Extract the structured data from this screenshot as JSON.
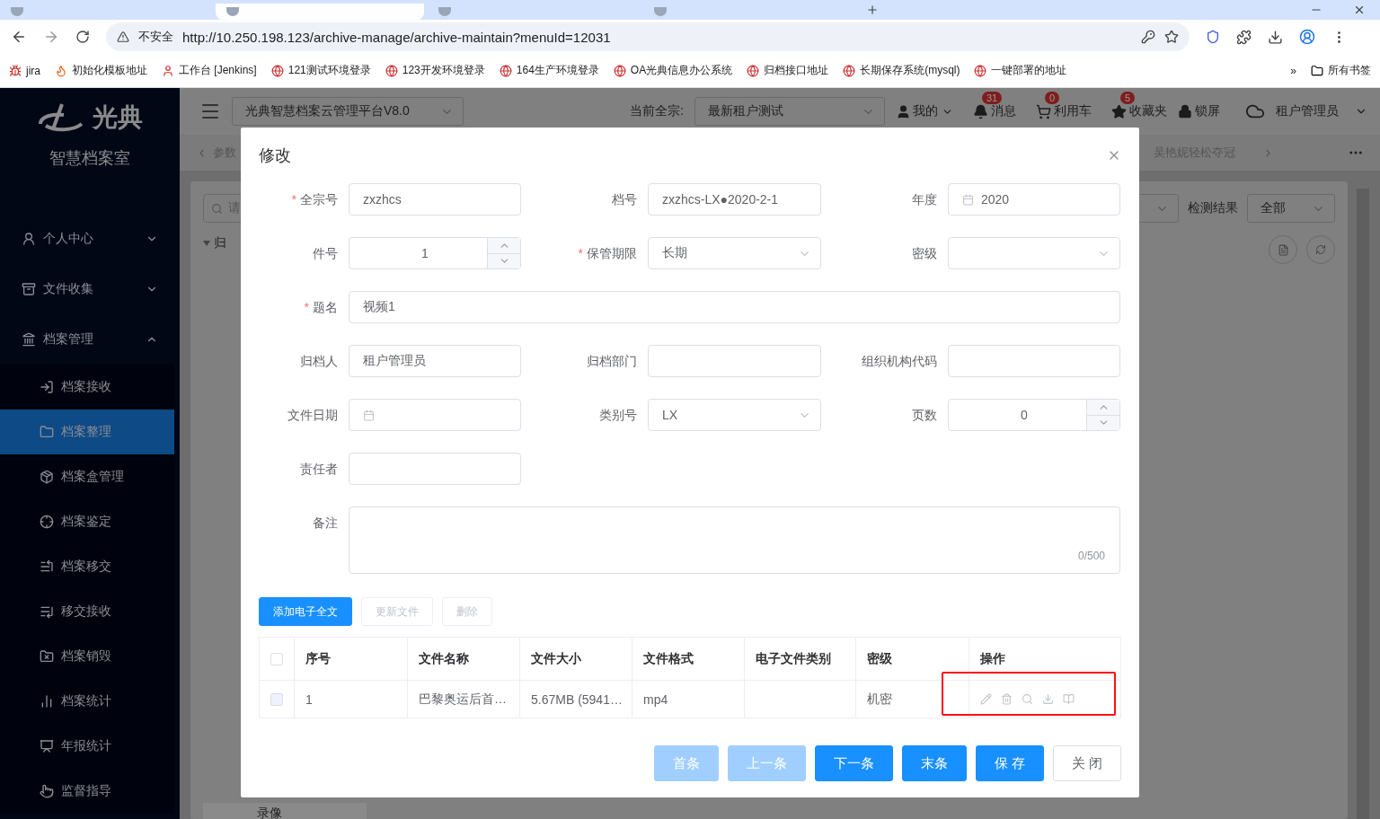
{
  "browser": {
    "insecure_label": "不安全",
    "url": "http://10.250.198.123/archive-manage/archive-maintain?menuId=12031",
    "bookmarks": [
      "jira",
      "初始化模板地址",
      "工作台 [Jenkins]",
      "121测试环境登录",
      "123开发环境登录",
      "164生产环境登录",
      "OA光典信息办公系统",
      "归档接口地址",
      "长期保存系统(mysql)",
      "一键部署的地址"
    ],
    "more": "»",
    "all_bookmarks": "所有书签"
  },
  "sidebar": {
    "logo": "光典",
    "subtitle": "智慧档案室",
    "items": [
      {
        "label": "个人中心",
        "expanded": false,
        "selected": false
      },
      {
        "label": "文件收集",
        "expanded": false,
        "selected": false
      },
      {
        "label": "档案管理",
        "expanded": true,
        "selected": false,
        "children": [
          {
            "label": "档案接收",
            "selected": false
          },
          {
            "label": "档案整理",
            "selected": true
          },
          {
            "label": "档案盒管理",
            "selected": false
          },
          {
            "label": "档案鉴定",
            "selected": false
          },
          {
            "label": "档案移交",
            "selected": false
          },
          {
            "label": "移交接收",
            "selected": false
          },
          {
            "label": "档案销毁",
            "selected": false
          },
          {
            "label": "档案统计",
            "selected": false
          },
          {
            "label": "年报统计",
            "selected": false
          },
          {
            "label": "监督指导",
            "selected": false
          }
        ]
      }
    ]
  },
  "header": {
    "platform": "光典智慧档案云管理平台V8.0",
    "fonds_label": "当前全宗:",
    "fonds": "最新租户测试",
    "mine": "我的",
    "notices": [
      {
        "label": "消息",
        "count": "31"
      },
      {
        "label": "利用车",
        "count": "0"
      },
      {
        "label": "收藏夹",
        "count": "5"
      }
    ],
    "lock": "锁屏",
    "account": "租户管理员"
  },
  "breadcrumb": {
    "first": "参数",
    "marquee": "吴艳妮轻松夺冠"
  },
  "page": {
    "search_placeholder": "请",
    "tree_root": "归",
    "filter_label": "检测结果",
    "filter_value": "全部",
    "footer_item": "录像"
  },
  "dialog": {
    "title": "修改",
    "required_mark": "*",
    "fields": [
      {
        "label": "全宗号",
        "kind": "text",
        "value": "zxzhcs",
        "required": true,
        "wide": false
      },
      {
        "label": "档号",
        "kind": "text",
        "value": "zxzhcs-LX●2020-2-1",
        "required": false,
        "wide": false
      },
      {
        "label": "年度",
        "kind": "date",
        "value": "2020",
        "required": false,
        "wide": false
      },
      {
        "label": "件号",
        "kind": "number",
        "value": "1",
        "required": false,
        "wide": false
      },
      {
        "label": "保管期限",
        "kind": "select",
        "value": "长期",
        "required": true,
        "wide": false
      },
      {
        "label": "密级",
        "kind": "select",
        "required": false,
        "wide": false
      },
      {
        "label": "题名",
        "kind": "text",
        "value": "视频1",
        "required": true,
        "wide": true
      },
      {
        "label": "归档人",
        "kind": "text",
        "value": "租户管理员",
        "required": false,
        "wide": false
      },
      {
        "label": "归档部门",
        "kind": "text",
        "required": false,
        "wide": false
      },
      {
        "label": "组织机构代码",
        "kind": "text",
        "required": false,
        "wide": false
      },
      {
        "label": "文件日期",
        "kind": "date",
        "required": false,
        "wide": false
      },
      {
        "label": "类别号",
        "kind": "select",
        "value": "LX",
        "required": false,
        "wide": false
      },
      {
        "label": "页数",
        "kind": "number",
        "value": "0",
        "required": false,
        "wide": false
      },
      {
        "label": "责任者",
        "kind": "text",
        "required": false,
        "wide": false
      },
      {
        "label": "备注",
        "kind": "textarea",
        "counter": "0/500",
        "required": false,
        "wide": true
      }
    ],
    "file_buttons": [
      {
        "label": "添加电子全文",
        "kind": "primary",
        "disabled": false
      },
      {
        "label": "更新文件",
        "kind": "default",
        "disabled": true
      },
      {
        "label": "删除",
        "kind": "default",
        "disabled": true
      }
    ],
    "table": {
      "select_all_checked": false,
      "actions_highlighted": true,
      "columns": [
        "序号",
        "文件名称",
        "文件大小",
        "文件格式",
        "电子文件类别",
        "密级",
        "操作"
      ],
      "rows": [
        {
          "checked": false,
          "disabled": true,
          "actions_disabled": true,
          "index": "1",
          "file_name": "巴黎奥运后首…",
          "file_size": "5.67MB (5941…",
          "format": "mp4",
          "security": "机密"
        }
      ]
    },
    "footer_buttons": [
      {
        "label": "首条",
        "kind": "primary",
        "disabled": true
      },
      {
        "label": "上一条",
        "kind": "primary",
        "disabled": true
      },
      {
        "label": "下一条",
        "kind": "primary",
        "disabled": false
      },
      {
        "label": "末条",
        "kind": "primary",
        "disabled": false
      },
      {
        "label": "保 存",
        "kind": "primary",
        "disabled": false
      },
      {
        "label": "关 闭",
        "kind": "default",
        "disabled": false
      }
    ]
  }
}
